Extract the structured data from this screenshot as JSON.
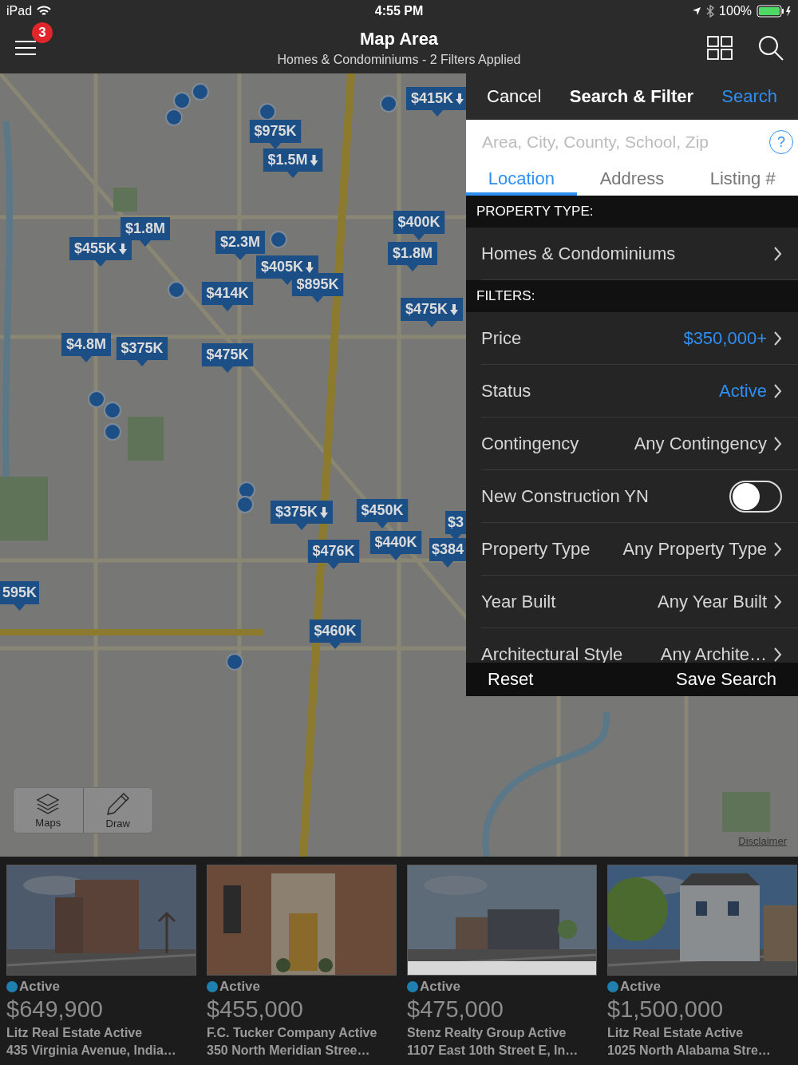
{
  "status_bar": {
    "device": "iPad",
    "time": "4:55 PM",
    "battery": "100%"
  },
  "nav": {
    "badge": "3",
    "title": "Map Area",
    "subtitle": "Homes & Condominiums - 2 Filters Applied"
  },
  "map": {
    "pins": [
      {
        "label": "$415K",
        "reduced": true
      },
      {
        "label": "$975K",
        "reduced": false
      },
      {
        "label": "$1.5M",
        "reduced": true
      },
      {
        "label": "$1.8M",
        "reduced": false
      },
      {
        "label": "$400K",
        "reduced": false
      },
      {
        "label": "$2.3M",
        "reduced": false
      },
      {
        "label": "$455K",
        "reduced": true
      },
      {
        "label": "$1.8M",
        "reduced": false
      },
      {
        "label": "$405K",
        "reduced": true
      },
      {
        "label": "$895K",
        "reduced": false
      },
      {
        "label": "$414K",
        "reduced": false
      },
      {
        "label": "$475K",
        "reduced": true
      },
      {
        "label": "$4.8M",
        "reduced": false
      },
      {
        "label": "$375K",
        "reduced": false
      },
      {
        "label": "$475K",
        "reduced": false
      },
      {
        "label": "$375K",
        "reduced": true
      },
      {
        "label": "$450K",
        "reduced": false
      },
      {
        "label": "$3",
        "reduced": false
      },
      {
        "label": "$440K",
        "reduced": false
      },
      {
        "label": "$476K",
        "reduced": false
      },
      {
        "label": "$384",
        "reduced": false
      },
      {
        "label": "595K",
        "reduced": false
      },
      {
        "label": "$460K",
        "reduced": false
      }
    ],
    "tools": [
      {
        "kind": "layers",
        "label": "Maps"
      },
      {
        "kind": "draw",
        "label": "Draw"
      }
    ],
    "disclaimer": "Disclaimer"
  },
  "filter_panel": {
    "cancel": "Cancel",
    "title": "Search & Filter",
    "search": "Search",
    "search_field": {
      "placeholder": "Area, City, County, School, Zip"
    },
    "help": "?",
    "tabs": [
      {
        "label": "Location",
        "selected": true
      },
      {
        "label": "Address",
        "selected": false
      },
      {
        "label": "Listing #",
        "selected": false
      }
    ],
    "sections": [
      {
        "heading": "PROPERTY TYPE:",
        "rows": [
          {
            "kind": "link",
            "label": "Homes & Condominiums"
          }
        ]
      },
      {
        "heading": "FILTERS:",
        "rows": [
          {
            "kind": "link",
            "label": "Price",
            "value": "$350,000+",
            "applied": true
          },
          {
            "kind": "link",
            "label": "Status",
            "value": "Active",
            "applied": true
          },
          {
            "kind": "link",
            "label": "Contingency",
            "value": "Any Contingency",
            "applied": false
          },
          {
            "kind": "toggle",
            "label": "New Construction YN",
            "on": false
          },
          {
            "kind": "link",
            "label": "Property Type",
            "value": "Any Property Type",
            "applied": false
          },
          {
            "kind": "link",
            "label": "Year Built",
            "value": "Any Year Built",
            "applied": false
          },
          {
            "kind": "link",
            "label": "Architectural Style",
            "value": "Any Archite…",
            "applied": false
          }
        ]
      }
    ],
    "footer": {
      "reset": "Reset",
      "save": "Save Search"
    }
  },
  "listings": [
    {
      "status": "Active",
      "price": "$649,900",
      "brokerage": "Litz Real Estate Active",
      "address": "435 Virginia Avenue, India…"
    },
    {
      "status": "Active",
      "price": "$455,000",
      "brokerage": "F.C. Tucker Company Active",
      "address": "350 North Meridian Stree…"
    },
    {
      "status": "Active",
      "price": "$475,000",
      "brokerage": "Stenz Realty Group Active",
      "address": "1107 East 10th Street E, In…"
    },
    {
      "status": "Active",
      "price": "$1,500,000",
      "brokerage": "Litz Real Estate Active",
      "address": "1025 North Alabama Stre…"
    }
  ]
}
